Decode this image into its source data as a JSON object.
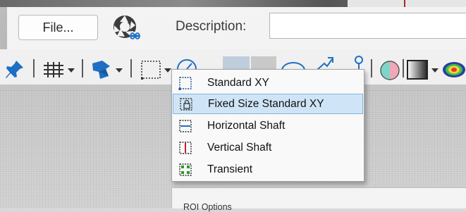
{
  "header": {
    "file_button": "File...",
    "description_label": "Description:",
    "description_value": ""
  },
  "toolbar": {
    "items": [
      {
        "icon": "pin-icon"
      },
      {
        "icon": "grid-icon"
      },
      {
        "icon": "palette-icon"
      },
      {
        "icon": "roi-selection-icon"
      },
      {
        "icon": "gauge-icon"
      },
      {
        "icon": "ellipse-icon"
      },
      {
        "icon": "arrow-icon"
      },
      {
        "icon": "location-pin-icon"
      },
      {
        "icon": "color-wheel-icon"
      },
      {
        "icon": "gradient-icon"
      },
      {
        "icon": "heatmap-icon"
      }
    ]
  },
  "roi_menu": {
    "selected_index": 1,
    "items": [
      {
        "label": "Standard XY",
        "icon": "standard-xy-icon"
      },
      {
        "label": "Fixed Size Standard XY",
        "icon": "fixed-size-lock-icon"
      },
      {
        "label": "Horizontal Shaft",
        "icon": "horizontal-shaft-icon"
      },
      {
        "label": "Vertical Shaft",
        "icon": "vertical-shaft-icon"
      },
      {
        "label": "Transient",
        "icon": "transient-icon"
      }
    ]
  },
  "roi_panel": {
    "title": "ROI Options"
  },
  "colors": {
    "selection_bg": "#cfe5f7",
    "selection_border": "#82b4dc",
    "pin_blue": "#1e6fc4",
    "shaft_red": "#d01e1e",
    "transient_green": "#2a9a2a"
  }
}
